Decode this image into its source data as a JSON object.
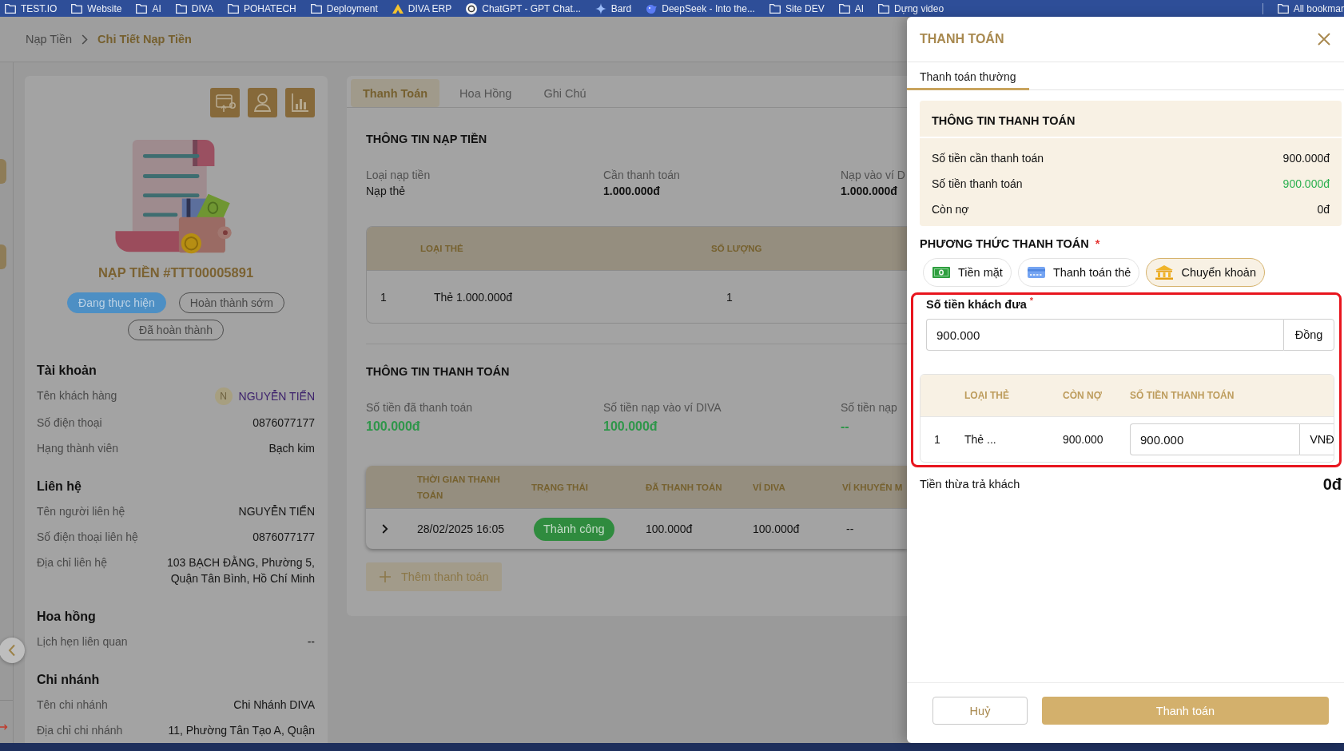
{
  "bookmarks_bar": {
    "items": [
      {
        "label": "TEST.IO",
        "kind": "folder"
      },
      {
        "label": "Website",
        "kind": "folder"
      },
      {
        "label": "AI",
        "kind": "folder"
      },
      {
        "label": "DIVA",
        "kind": "folder"
      },
      {
        "label": "POHATECH",
        "kind": "folder"
      },
      {
        "label": "Deployment",
        "kind": "folder"
      },
      {
        "label": "DIVA ERP",
        "kind": "triangle"
      },
      {
        "label": "ChatGPT - GPT Chat...",
        "kind": "ring"
      },
      {
        "label": "Bard",
        "kind": "sparkle"
      },
      {
        "label": "DeepSeek - Into the...",
        "kind": "whale"
      },
      {
        "label": "Site DEV",
        "kind": "folder"
      },
      {
        "label": "AI",
        "kind": "folder"
      },
      {
        "label": "Dựng video",
        "kind": "folder"
      }
    ],
    "all_bookmarks": "All bookmar"
  },
  "breadcrumb": [
    {
      "label": "Nạp Tiền",
      "selected": false
    },
    {
      "label": "Chi Tiết Nạp Tiền",
      "selected": true
    }
  ],
  "order": {
    "title": "NẠP TIỀN #TTT00005891",
    "statuses": [
      {
        "label": "Đang thực hiện",
        "selected": true
      },
      {
        "label": "Hoàn thành sớm",
        "selected": false
      },
      {
        "label": "Đã hoàn thành",
        "selected": false
      }
    ],
    "sections": [
      {
        "title": "Tài khoản",
        "rows": [
          {
            "label": "Tên khách hàng",
            "value": "NGUYỄN TIẾN",
            "kind": "customer",
            "avatar": "N"
          },
          {
            "label": "Số điện thoại",
            "value": "0876077177",
            "kind": "text"
          },
          {
            "label": "Hạng thành viên",
            "value": "Bạch kim",
            "kind": "text"
          }
        ]
      },
      {
        "title": "Liên hệ",
        "rows": [
          {
            "label": "Tên người liên hệ",
            "value": "NGUYỄN TIẾN",
            "kind": "text"
          },
          {
            "label": "Số điện thoại liên hệ",
            "value": "0876077177",
            "kind": "text"
          },
          {
            "label": "Địa chỉ liên hệ",
            "value": "103 BẠCH ĐẰNG, Phường 5, Quận Tân Bình, Hồ Chí Minh",
            "kind": "text"
          }
        ]
      },
      {
        "title": "Hoa hồng",
        "rows": [
          {
            "label": "Lịch hẹn liên quan",
            "value": "--",
            "kind": "text"
          }
        ]
      },
      {
        "title": "Chi nhánh",
        "rows": [
          {
            "label": "Tên chi nhánh",
            "value": "Chi Nhánh DIVA",
            "kind": "text"
          },
          {
            "label": "Địa chỉ chi nhánh",
            "value": "11, Phường Tân Tạo A, Quận",
            "kind": "text"
          }
        ]
      }
    ]
  },
  "detail": {
    "tabs": [
      {
        "label": "Thanh Toán",
        "selected": true
      },
      {
        "label": "Hoa Hồng",
        "selected": false
      },
      {
        "label": "Ghi Chú",
        "selected": false
      }
    ],
    "topup_info": {
      "title": "THÔNG TIN NẠP TIỀN",
      "fields": [
        {
          "label": "Loại nạp tiền",
          "value": "Nạp thẻ",
          "kind": "plain"
        },
        {
          "label": "Cần thanh toán",
          "value": "1.000.000đ",
          "kind": "amount"
        },
        {
          "label": "Nạp vào ví D",
          "value": "1.000.000đ",
          "kind": "amount"
        }
      ]
    },
    "cards_table": {
      "columns": [
        "LOẠI THẺ",
        "SỐ LƯỢNG"
      ],
      "rows": [
        {
          "index": "1",
          "card_type": "Thẻ 1.000.000đ",
          "quantity": "1"
        }
      ]
    },
    "payment_info": {
      "title": "THÔNG TIN THANH TOÁN",
      "fields": [
        {
          "label": "Số tiền đã thanh toán",
          "value": "100.000đ",
          "kind": "paid"
        },
        {
          "label": "Số tiền nạp vào ví DIVA",
          "value": "100.000đ",
          "kind": "paid"
        },
        {
          "label": "Số tiền nạp",
          "value": "--",
          "kind": "paid"
        }
      ]
    },
    "payments_table": {
      "columns": [
        "THỜI GIAN THANH TOÁN",
        "TRẠNG THÁI",
        "ĐÃ THANH TOÁN",
        "VÍ DIVA",
        "VÍ KHUYẾN M"
      ],
      "rows": [
        {
          "expanded": false,
          "time": "28/02/2025 16:05",
          "status": "Thành công",
          "paid": "100.000đ",
          "wallet": "100.000đ",
          "promo_wallet": "--"
        }
      ]
    },
    "add_payment": {
      "label": "Thêm thanh toán",
      "disabled": true
    }
  },
  "drawer": {
    "title": "THANH TOÁN",
    "tabs": [
      {
        "label": "Thanh toán thường",
        "selected": true
      }
    ],
    "summary": {
      "title": "THÔNG TIN THANH TOÁN",
      "rows": [
        {
          "label": "Số tiền cần thanh toán",
          "value": "900.000đ",
          "kind": "plain"
        },
        {
          "label": "Số tiền thanh toán",
          "value": "900.000đ",
          "kind": "positive"
        },
        {
          "label": "Còn nợ",
          "value": "0đ",
          "kind": "plain"
        }
      ]
    },
    "method": {
      "label": "PHƯƠNG THỨC THANH TOÁN",
      "required_mark": "*",
      "options": [
        {
          "label": "Tiền mặt",
          "kind": "cash",
          "selected": false
        },
        {
          "label": "Thanh toán thẻ",
          "kind": "card",
          "selected": false
        },
        {
          "label": "Chuyển khoản",
          "kind": "transfer",
          "selected": true
        }
      ]
    },
    "amount": {
      "label": "Số tiền khách đưa",
      "required_mark": "*",
      "value": "900.000",
      "unit": "Đồng",
      "highlighted": true
    },
    "allocation_table": {
      "columns": [
        "LOẠI THẺ",
        "CÒN NỢ",
        "SỐ TIỀN THANH TOÁN"
      ],
      "rows": [
        {
          "index": "1",
          "card_type": "Thẻ ...",
          "debt": "900.000",
          "amount": "900.000",
          "unit": "VNĐ"
        }
      ]
    },
    "change": {
      "label": "Tiền thừa trả khách",
      "value": "0đ"
    },
    "buttons": [
      {
        "label": "Huỷ",
        "kind": "secondary"
      },
      {
        "label": "Thanh toán",
        "kind": "primary"
      }
    ]
  }
}
